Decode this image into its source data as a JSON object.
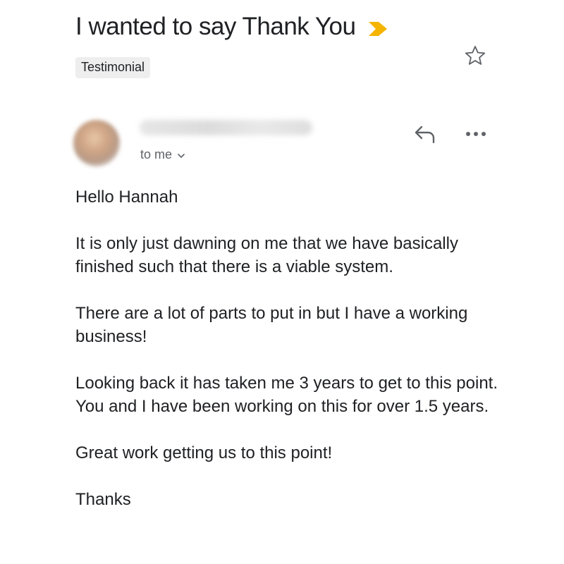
{
  "email": {
    "subject": "I wanted to say Thank You",
    "label": "Testimonial",
    "recipient": "to me",
    "body": {
      "greeting": "Hello Hannah",
      "paragraph_1": "It is only just dawning on me that we have basically finished such that there is a viable system.",
      "paragraph_2": "There are a lot of parts to put in but I have a working business!",
      "paragraph_3": "Looking back it has taken me 3 years to get to this point. You and I have been working on this for over 1.5 years.",
      "paragraph_4": "Great work getting us to this point!",
      "signoff": "Thanks"
    }
  },
  "icons": {
    "importance": "importance-marker-icon",
    "star": "star-icon",
    "reply": "reply-icon",
    "more": "more-options-icon",
    "recipient_toggle": "chevron-down-icon"
  },
  "colors": {
    "importance_marker": "#f4b400",
    "label_background": "#eeeeee",
    "secondary_text": "#5f6368",
    "icon_gray": "#5f6368"
  }
}
